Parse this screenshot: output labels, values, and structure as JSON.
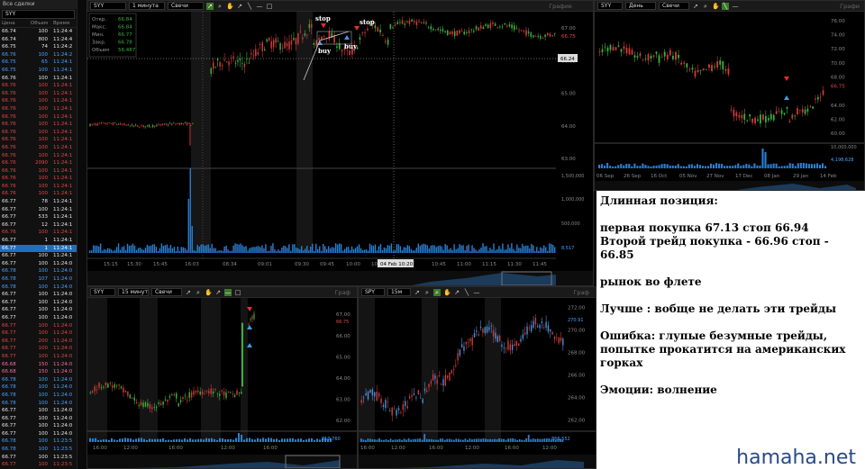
{
  "tas": {
    "title": "Все сделки",
    "symbol": "SYY",
    "columns": [
      "Цена",
      "Объем",
      "Время"
    ],
    "rows": [
      [
        "66.74",
        "100",
        "11:24:4",
        "w"
      ],
      [
        "66.74",
        "800",
        "11:24:4",
        "w"
      ],
      [
        "66.75",
        "74",
        "11:24:2",
        "w"
      ],
      [
        "66.76",
        "100",
        "11:24:2",
        "b"
      ],
      [
        "66.75",
        "65",
        "11:24:1",
        "b"
      ],
      [
        "66.75",
        "100",
        "11:24:1",
        "b"
      ],
      [
        "66.76",
        "100",
        "11:24:1",
        "w"
      ],
      [
        "66.76",
        "100",
        "11:24:1",
        "r"
      ],
      [
        "66.76",
        "100",
        "11:24:1",
        "r"
      ],
      [
        "66.76",
        "100",
        "11:24:1",
        "r"
      ],
      [
        "66.76",
        "100",
        "11:24:1",
        "r"
      ],
      [
        "66.76",
        "100",
        "11:24:1",
        "r"
      ],
      [
        "66.76",
        "100",
        "11:24:1",
        "r"
      ],
      [
        "66.76",
        "100",
        "11:24:1",
        "r"
      ],
      [
        "66.76",
        "100",
        "11:24:1",
        "r"
      ],
      [
        "66.76",
        "100",
        "11:24:1",
        "r"
      ],
      [
        "66.76",
        "100",
        "11:24:1",
        "r"
      ],
      [
        "66.76",
        "2090",
        "11:24:1",
        "r"
      ],
      [
        "66.76",
        "100",
        "11:24:1",
        "r"
      ],
      [
        "66.76",
        "100",
        "11:24:1",
        "r"
      ],
      [
        "66.76",
        "100",
        "11:24:1",
        "r"
      ],
      [
        "66.76",
        "100",
        "11:24:1",
        "r"
      ],
      [
        "66.77",
        "78",
        "11:24:1",
        "w"
      ],
      [
        "66.77",
        "100",
        "11:24:1",
        "w"
      ],
      [
        "66.77",
        "533",
        "11:24:1",
        "w"
      ],
      [
        "66.77",
        "12",
        "11:24:1",
        "w"
      ],
      [
        "66.76",
        "100",
        "11:24:1",
        "r"
      ],
      [
        "66.77",
        "1",
        "11:24:1",
        "w"
      ],
      [
        "66.77",
        "1",
        "11:24:1",
        "sel"
      ],
      [
        "66.77",
        "100",
        "11:24:1",
        "w"
      ],
      [
        "66.77",
        "100",
        "11:24:0",
        "w"
      ],
      [
        "66.78",
        "100",
        "11:24:0",
        "b"
      ],
      [
        "66.78",
        "107",
        "11:24:0",
        "b"
      ],
      [
        "66.78",
        "100",
        "11:24:0",
        "b"
      ],
      [
        "66.77",
        "100",
        "11:24:0",
        "w"
      ],
      [
        "66.77",
        "100",
        "11:24:0",
        "w"
      ],
      [
        "66.77",
        "100",
        "11:24:0",
        "w"
      ],
      [
        "66.77",
        "100",
        "11:24:0",
        "w"
      ],
      [
        "66.77",
        "100",
        "11:24:0",
        "r"
      ],
      [
        "66.77",
        "100",
        "11:24:0",
        "r"
      ],
      [
        "66.77",
        "200",
        "11:24:0",
        "r"
      ],
      [
        "66.77",
        "100",
        "11:24:0",
        "r"
      ],
      [
        "66.77",
        "100",
        "11:24:0",
        "r"
      ],
      [
        "66.68",
        "150",
        "11:24:0",
        "p"
      ],
      [
        "66.68",
        "150",
        "11:24:0",
        "p"
      ],
      [
        "66.78",
        "100",
        "11:24:0",
        "b"
      ],
      [
        "66.78",
        "100",
        "11:24:0",
        "b"
      ],
      [
        "66.78",
        "100",
        "11:24:0",
        "b"
      ],
      [
        "66.78",
        "100",
        "11:24:0",
        "b"
      ],
      [
        "66.77",
        "100",
        "11:24:0",
        "w"
      ],
      [
        "66.77",
        "100",
        "11:24:0",
        "w"
      ],
      [
        "66.77",
        "100",
        "11:24:0",
        "w"
      ],
      [
        "66.77",
        "100",
        "11:24:0",
        "w"
      ],
      [
        "66.78",
        "100",
        "11:23:5",
        "b"
      ],
      [
        "66.78",
        "100",
        "11:23:5",
        "b"
      ],
      [
        "66.77",
        "100",
        "11:23:5",
        "w"
      ],
      [
        "66.77",
        "100",
        "11:23:5",
        "r"
      ],
      [
        "66.77",
        "100",
        "11:23:5",
        "r"
      ],
      [
        "66.77",
        "100",
        "11:23:5",
        "r"
      ]
    ]
  },
  "main": {
    "symbol": "SYY",
    "interval": "1 минута",
    "type": "Свечи",
    "title": "График",
    "info_labels": [
      "Откр.",
      "Макс.",
      "Мин.",
      "Закр.",
      "Объем"
    ],
    "info_values": [
      "66.84",
      "66.84",
      "66.77",
      "66.78",
      "56,487"
    ],
    "watermark_sym": "SYY",
    "watermark_name": "Sysco Corp",
    "price_ticks": [
      "67.00",
      "66.00",
      "65.00",
      "64.00",
      "63.00"
    ],
    "current_price": "66.24",
    "price_red": "66.75",
    "vol_ticks": [
      "1,500,000",
      "1,000,000",
      "500,000"
    ],
    "vol_last": "8,517",
    "time_ticks": [
      "15:15",
      "15:30",
      "15:45",
      "16:03",
      "08:34",
      "09:01",
      "09:30",
      "09:45",
      "10:00",
      "10:15",
      "10:30",
      "10:45",
      "11:00",
      "11:15",
      "11:30",
      "11:45"
    ],
    "crosshair_time": "04 Feb 10:20",
    "annotations": [
      "stop",
      "stop",
      "buy",
      "buy"
    ]
  },
  "daily": {
    "symbol": "SYY",
    "interval": "День",
    "type": "Свечи",
    "title": "Графи",
    "watermark_sym": "SYY",
    "watermark_name": "Sysco Corp",
    "price_ticks": [
      "76.00",
      "74.00",
      "72.00",
      "70.00",
      "68.00",
      "66.75",
      "64.00",
      "62.00",
      "60.00"
    ],
    "vol_ticks": [
      "10,000,000",
      "4,198,628"
    ],
    "time_ticks": [
      "06 Sep",
      "26 Sep",
      "16 Oct",
      "05 Nov",
      "27 Nov",
      "17 Dec",
      "08 Jan",
      "29 Jan",
      "14 Feb"
    ]
  },
  "m15": {
    "symbol": "SYY",
    "interval": "15 минут",
    "type": "Свечи",
    "title": "Граф",
    "watermark_sym": "SYY",
    "watermark_name": "Sysco Corp",
    "price_ticks": [
      "67.00",
      "66.00",
      "65.00",
      "64.00",
      "63.00",
      "62.00"
    ],
    "price_red": "66.75",
    "vol_last": "210,760",
    "time_ticks": [
      "16:00",
      "12:00",
      "16:00",
      "12:00",
      "16:00"
    ]
  },
  "spy": {
    "symbol": "SPY",
    "interval": "15м",
    "title": "Граф",
    "watermark_sym": "SPY",
    "watermark_name": "SPDR S&P 500",
    "price_ticks": [
      "272.00",
      "270.00",
      "268.00",
      "266.00",
      "264.00",
      "262.00"
    ],
    "price_blue": "270.91",
    "vol_last": "866,552",
    "time_ticks": [
      "16:00",
      "12:00",
      "16:00",
      "12:00",
      "16:00",
      "12:00"
    ]
  },
  "notes": {
    "heading": "Длинная позиция:",
    "line1": "первая покупка 67.13 стоп 66.94",
    "line2": "Второй трейд покупка - 66.96 стоп - 66.85",
    "line3": "рынок во флете",
    "line4": "Лучше : вобще не делать эти трейды",
    "line5": "Ошибка: глупые безумные трейды, попытке прокатится на американских горках",
    "line6": "Эмоции: волнение",
    "brand": "hamaha.net"
  },
  "colors": {
    "up": "#3fae3f",
    "down": "#d03a3a",
    "spy_up": "#4a8fd8",
    "vol": "#2a7fd4",
    "cur_price_bg": "#dddddd"
  }
}
